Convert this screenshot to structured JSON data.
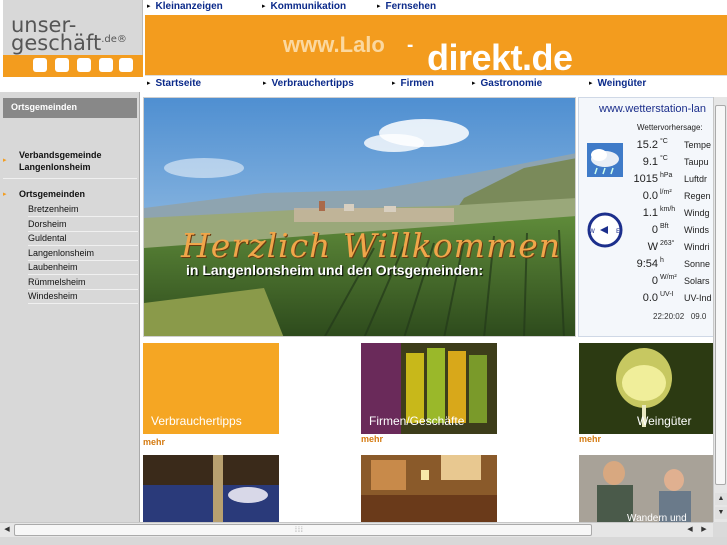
{
  "logo": {
    "line1": "unser-",
    "line2": "geschäft",
    "tld": ".de",
    "reg": "®"
  },
  "topnav": [
    "Kleinanzeigen",
    "Kommunikation",
    "Fernsehen"
  ],
  "banner": {
    "www": "www.Lalo",
    "dash": "-",
    "direkt": "direkt.de"
  },
  "subnav": [
    "Startseite",
    "Verbrauchertipps",
    "Firmen",
    "Gastronomie",
    "Weingüter"
  ],
  "sidebar": {
    "header": "Ortsgemeinden",
    "verband": [
      "Verbandsgemeinde",
      "Langenlonsheim"
    ],
    "orts": "Ortsgemeinden",
    "items": [
      "Bretzenheim",
      "Dorsheim",
      "Guldental",
      "Langenlonsheim",
      "Laubenheim",
      "Rümmelsheim",
      "Windesheim"
    ]
  },
  "hero": {
    "title": "Herzlich Willkommen",
    "subtitle": "in Langenlonsheim und den Ortsgemeinden:"
  },
  "weather": {
    "station": "www.wetterstation-lan",
    "forecast": "Wettervorhersage:",
    "rows": [
      {
        "value": "15.2",
        "unit": "°C",
        "label": "Tempe"
      },
      {
        "value": "9.1",
        "unit": "°C",
        "label": "Taupu"
      },
      {
        "value": "1015",
        "unit": "hPa",
        "label": "Luftdr"
      },
      {
        "value": "0.0",
        "unit": "l/m²",
        "label": "Regen"
      },
      {
        "value": "1.1",
        "unit": "km/h",
        "label": "Windg"
      },
      {
        "value": "0",
        "unit": "Bft",
        "label": "Winds"
      },
      {
        "value": "W",
        "unit": "263°",
        "label": "Windri"
      },
      {
        "value": "9:54",
        "unit": "h",
        "label": "Sonne"
      },
      {
        "value": "0",
        "unit": "W/m²",
        "label": "Solars"
      },
      {
        "value": "0.0",
        "unit": "UV-I",
        "label": "UV-Ind"
      }
    ],
    "time1": "22:20:02",
    "time2": "09.0"
  },
  "tiles": [
    {
      "caption": "Verbrauchertipps",
      "more": "mehr"
    },
    {
      "caption": "Firmen/Geschäfte",
      "more": "mehr"
    },
    {
      "caption": "Weingüter",
      "more": "mehr"
    },
    {
      "caption": "",
      "more": ""
    },
    {
      "caption": "",
      "more": ""
    },
    {
      "caption": "Wandern und",
      "more": ""
    }
  ],
  "colors": {
    "orange": "#f39c1e",
    "navBlue": "#0b2a8a",
    "sidebarGray": "#d8d8d8"
  },
  "icons": {
    "nav-arrow": "▸",
    "scroll-up": "▲",
    "scroll-down": "▼",
    "scroll-left": "◀",
    "scroll-right": "▶"
  }
}
